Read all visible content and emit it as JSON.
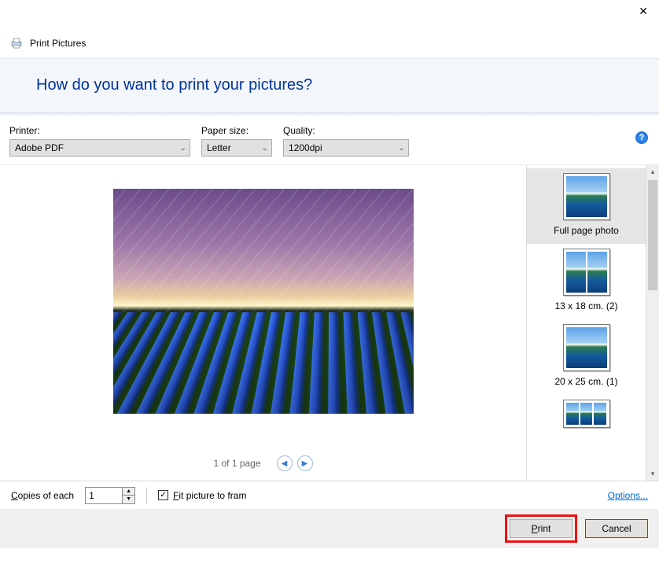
{
  "window": {
    "title": "Print Pictures",
    "prompt": "How do you want to print your pictures?"
  },
  "options": {
    "printer_label": "Printer:",
    "printer_value": "Adobe PDF",
    "paper_label": "Paper size:",
    "paper_value": "Letter",
    "quality_label": "Quality:",
    "quality_value": "1200dpi",
    "help_glyph": "?"
  },
  "pager": {
    "text": "1 of 1 page"
  },
  "layouts": [
    {
      "label": "Full page photo",
      "panes": 1
    },
    {
      "label": "13 x 18 cm. (2)",
      "panes": 2
    },
    {
      "label": "20 x 25 cm. (1)",
      "panes": 1
    },
    {
      "label": "",
      "panes": 3
    }
  ],
  "bottom": {
    "copies_prefix": "C",
    "copies_rest": "opies of each",
    "copies_value": "1",
    "fit_prefix": "F",
    "fit_rest": "it picture to fram",
    "options_link": "Options..."
  },
  "actions": {
    "print_prefix": "P",
    "print_rest": "rint",
    "cancel": "Cancel"
  }
}
